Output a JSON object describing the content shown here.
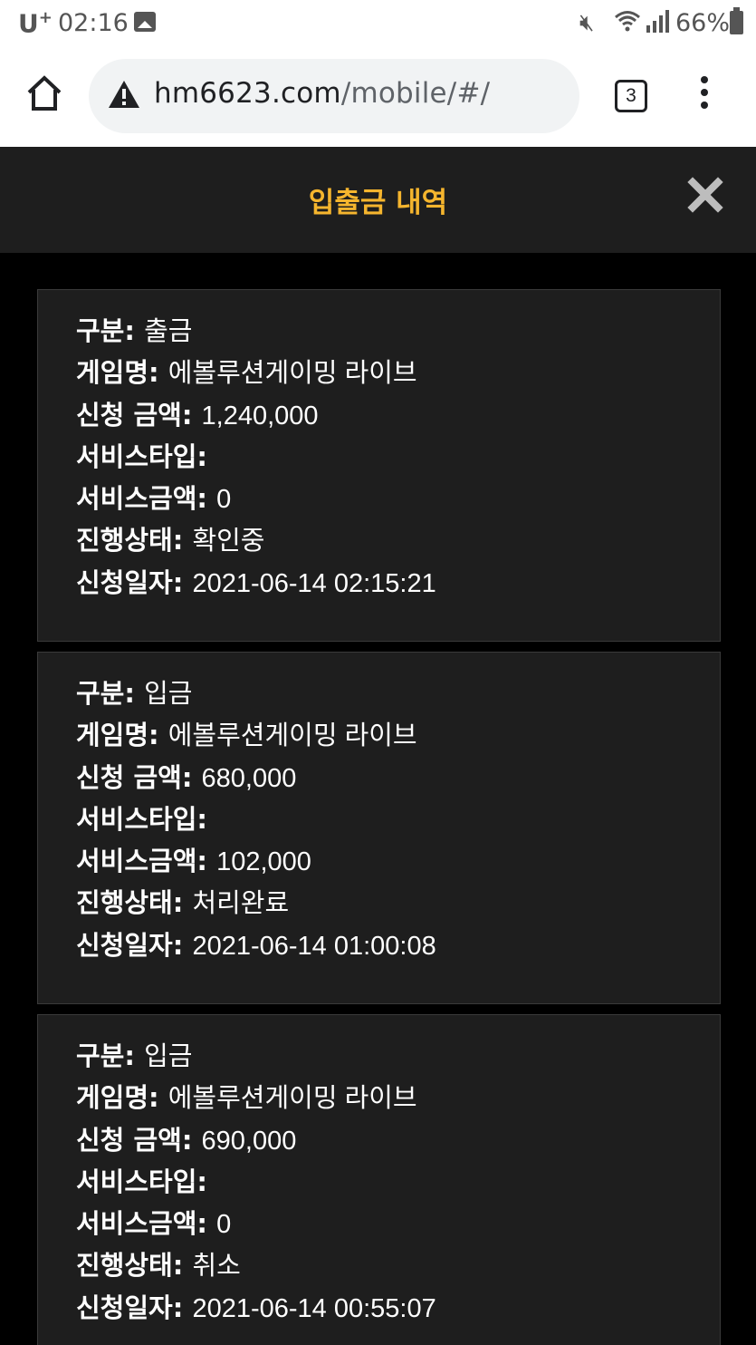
{
  "status_bar": {
    "carrier": "U",
    "carrier_sup": "+",
    "time": "02:16",
    "battery": "66%"
  },
  "browser": {
    "url_host": "hm6623.com",
    "url_path": "/mobile/#/",
    "tab_count": "3"
  },
  "modal": {
    "title": "입출금 내역",
    "title_color": "#f5b52e"
  },
  "labels": {
    "type": "구분",
    "game": "게임명",
    "amount": "신청 금액",
    "service_type": "서비스타입",
    "service_amount": "서비스금액",
    "status": "진행상태",
    "date": "신청일자"
  },
  "transactions": [
    {
      "type": "출금",
      "game": "에볼루션게이밍 라이브",
      "amount": "1,240,000",
      "service_type": "",
      "service_amount": "0",
      "status": "확인중",
      "date": "2021-06-14 02:15:21"
    },
    {
      "type": "입금",
      "game": "에볼루션게이밍 라이브",
      "amount": "680,000",
      "service_type": "",
      "service_amount": "102,000",
      "status": "처리완료",
      "date": "2021-06-14 01:00:08"
    },
    {
      "type": "입금",
      "game": "에볼루션게이밍 라이브",
      "amount": "690,000",
      "service_type": "",
      "service_amount": "0",
      "status": "취소",
      "date": "2021-06-14 00:55:07"
    }
  ]
}
